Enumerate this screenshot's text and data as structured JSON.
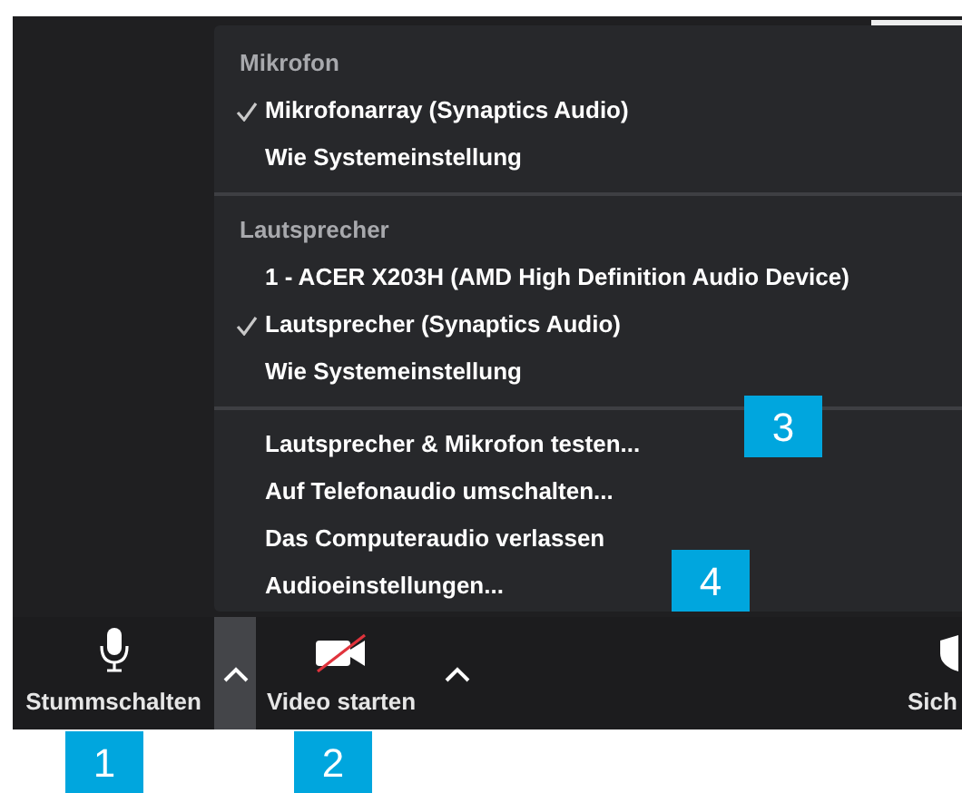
{
  "menu": {
    "sections": [
      {
        "header": "Mikrofon",
        "items": [
          {
            "label": "Mikrofonarray (Synaptics Audio)",
            "selected": true
          },
          {
            "label": "Wie Systemeinstellung",
            "selected": false
          }
        ]
      },
      {
        "header": "Lautsprecher",
        "items": [
          {
            "label": "1 - ACER X203H (AMD High Definition Audio Device)",
            "selected": false
          },
          {
            "label": "Lautsprecher (Synaptics Audio)",
            "selected": true
          },
          {
            "label": "Wie Systemeinstellung",
            "selected": false
          }
        ]
      }
    ],
    "actions": [
      "Lautsprecher & Mikrofon testen...",
      "Auf Telefonaudio umschalten...",
      "Das Computeraudio verlassen",
      "Audioeinstellungen..."
    ]
  },
  "toolbar": [
    {
      "kind": "mic",
      "label": "Stummschalten"
    },
    {
      "kind": "caret",
      "expanded": true
    },
    {
      "kind": "video",
      "label": "Video starten"
    },
    {
      "kind": "caret",
      "expanded": false
    },
    {
      "kind": "security",
      "label": "Sich"
    }
  ],
  "callouts": [
    {
      "label": "1"
    },
    {
      "label": "2"
    },
    {
      "label": "3"
    },
    {
      "label": "4"
    }
  ]
}
